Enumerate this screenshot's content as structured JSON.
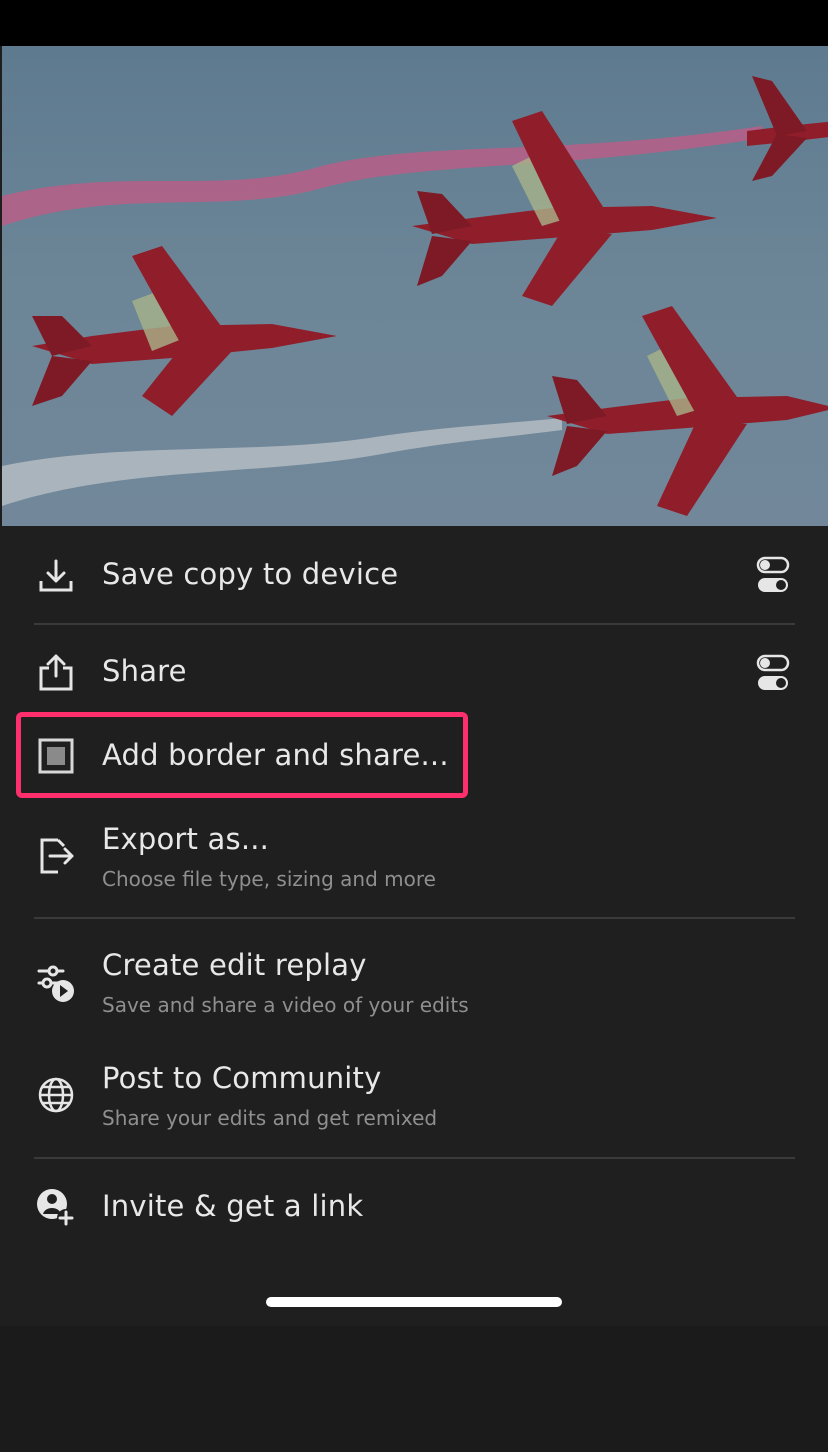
{
  "photo": {
    "subject": "aerobatic-jets-photo"
  },
  "menu": {
    "save": {
      "label": "Save copy to device",
      "icon": "download-icon",
      "settings_icon": "toggle-settings-icon"
    },
    "share": {
      "label": "Share",
      "icon": "share-icon",
      "settings_icon": "toggle-settings-icon"
    },
    "border": {
      "label": "Add border and share...",
      "icon": "border-frame-icon"
    },
    "export": {
      "label": "Export as...",
      "sublabel": "Choose file type, sizing and more",
      "icon": "export-icon"
    },
    "replay": {
      "label": "Create edit replay",
      "sublabel": "Save and share a video of your edits",
      "icon": "edit-replay-icon"
    },
    "community": {
      "label": "Post to Community",
      "sublabel": "Share your edits and get remixed",
      "icon": "globe-icon"
    },
    "invite": {
      "label": "Invite & get a link",
      "icon": "invite-user-icon"
    }
  },
  "colors": {
    "highlight": "#ff2f6e",
    "background": "#1f1f1f",
    "text": "#e8e8e8",
    "subtext": "#8f8f8f"
  }
}
